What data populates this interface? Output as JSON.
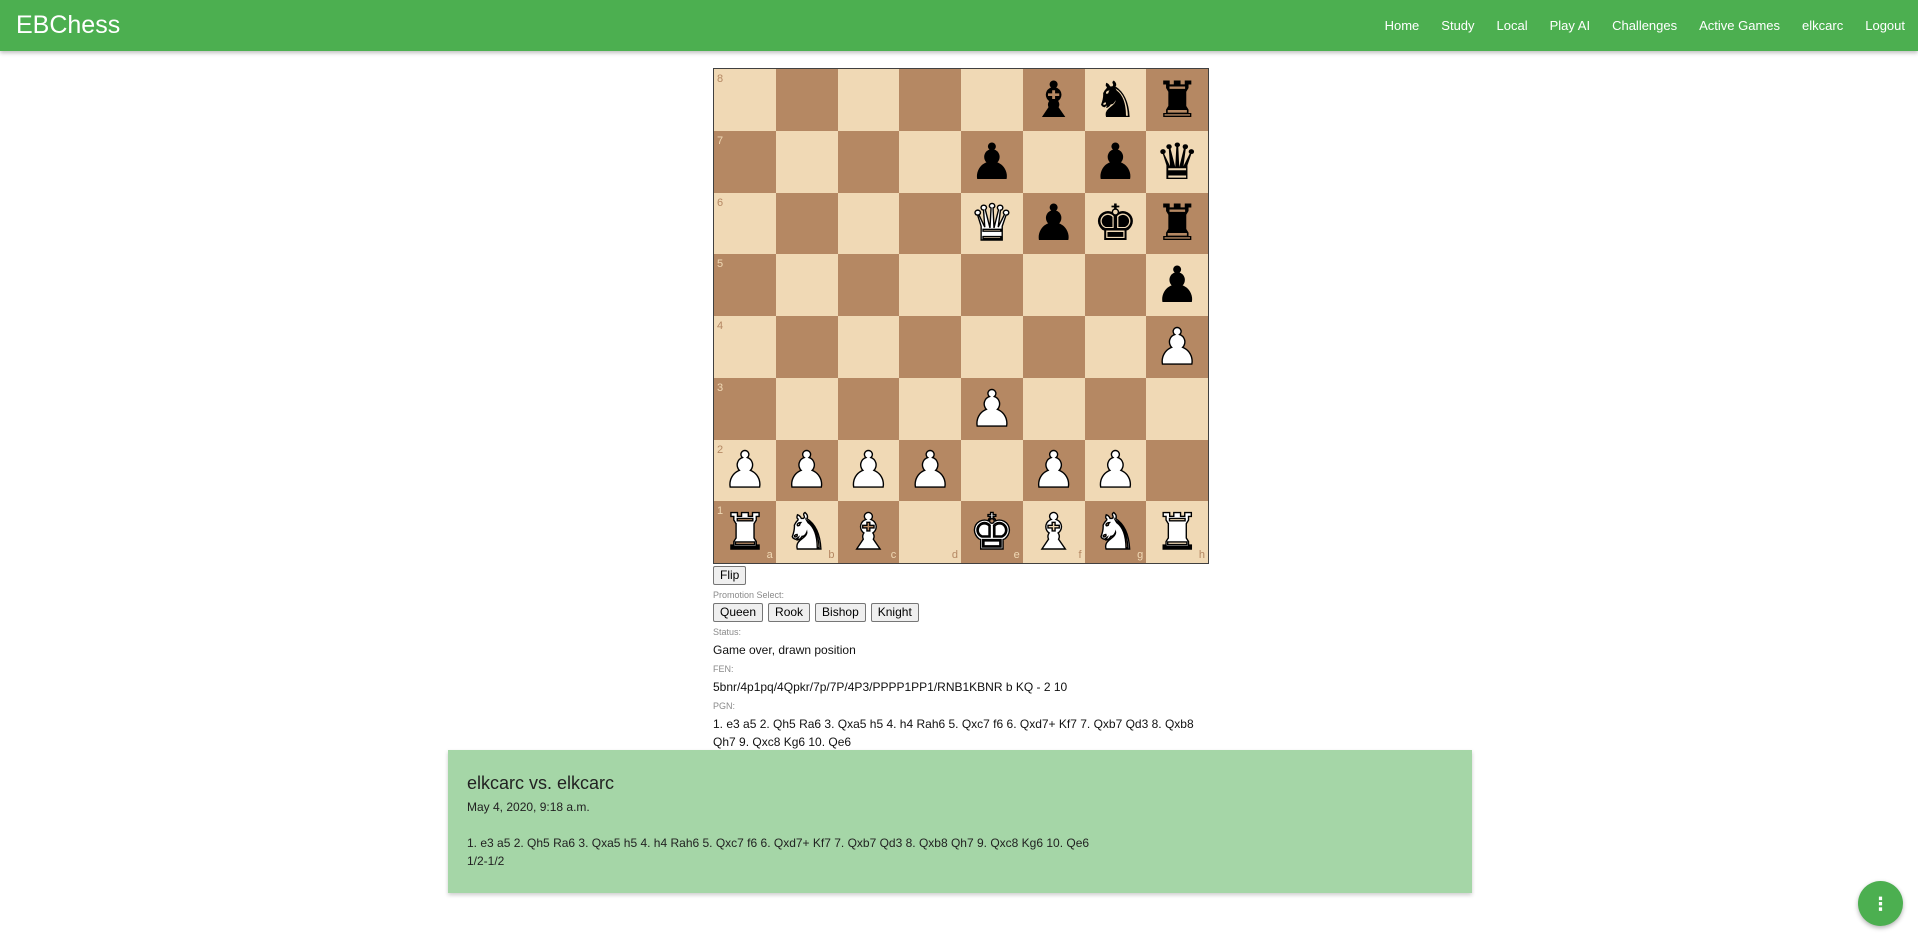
{
  "nav": {
    "brand": "EBChess",
    "links": [
      "Home",
      "Study",
      "Local",
      "Play AI",
      "Challenges",
      "Active Games",
      "elkcarc",
      "Logout"
    ]
  },
  "board": {
    "colors": {
      "light": "#f0d9b5",
      "dark": "#b58863"
    },
    "ranks": [
      "8",
      "7",
      "6",
      "5",
      "4",
      "3",
      "2",
      "1"
    ],
    "files": [
      "a",
      "b",
      "c",
      "d",
      "e",
      "f",
      "g",
      "h"
    ],
    "position": [
      [
        "",
        "",
        "",
        "",
        "",
        "b",
        "n",
        "r"
      ],
      [
        "",
        "",
        "",
        "",
        "p",
        "",
        "p",
        "q"
      ],
      [
        "",
        "",
        "",
        "",
        "Q",
        "p",
        "k",
        "r"
      ],
      [
        "",
        "",
        "",
        "",
        "",
        "",
        "",
        "p"
      ],
      [
        "",
        "",
        "",
        "",
        "",
        "",
        "",
        "P"
      ],
      [
        "",
        "",
        "",
        "",
        "P",
        "",
        "",
        ""
      ],
      [
        "P",
        "P",
        "P",
        "P",
        "",
        "P",
        "P",
        ""
      ],
      [
        "R",
        "N",
        "B",
        "",
        "K",
        "B",
        "N",
        "R"
      ]
    ]
  },
  "controls": {
    "flip_label": "Flip",
    "promotion_label": "Promotion Select:",
    "promotion_options": [
      "Queen",
      "Rook",
      "Bishop",
      "Knight"
    ],
    "status_label": "Status:",
    "status_value": "Game over, drawn position",
    "fen_label": "FEN:",
    "fen_value": "5bnr/4p1pq/4Qpkr/7p/7P/4P3/PPPP1PP1/RNB1KBNR b KQ - 2 10",
    "pgn_label": "PGN:",
    "pgn_value": "1. e3 a5 2. Qh5 Ra6 3. Qxa5 h5 4. h4 Rah6 5. Qxc7 f6 6. Qxd7+ Kf7 7. Qxb7 Qd3 8. Qxb8 Qh7 9. Qxc8 Kg6 10. Qe6"
  },
  "game_card": {
    "title": "elkcarc vs. elkcarc",
    "date": "May 4, 2020, 9:18 a.m.",
    "pgn": "1. e3 a5 2. Qh5 Ra6 3. Qxa5 h5 4. h4 Rah6 5. Qxc7 f6 6. Qxd7+ Kf7 7. Qxb7 Qd3 8. Qxb8 Qh7 9. Qxc8 Kg6 10. Qe6",
    "result": "1/2-1/2"
  },
  "fab": {
    "icon": "more-vert-icon",
    "glyph": "⋮"
  },
  "theme": {
    "accent": "#4caf50",
    "card_bg": "#a5d6a7"
  }
}
